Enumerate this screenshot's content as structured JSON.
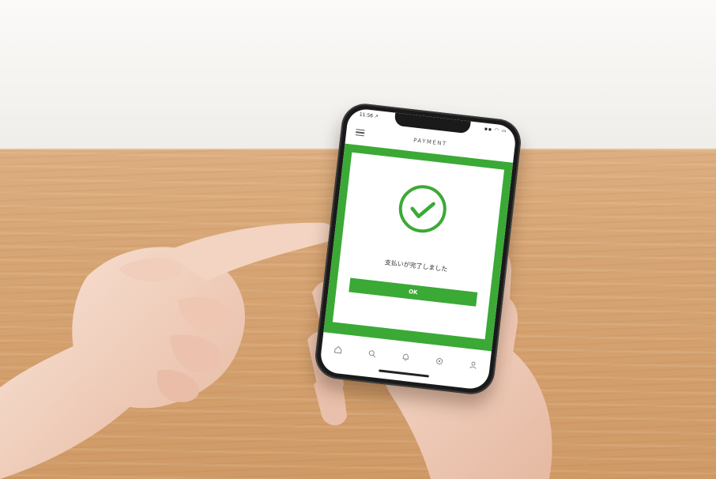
{
  "phone": {
    "status": {
      "time": "11:56 ↗",
      "icons": "▪▪ ◠ ▭"
    },
    "header": {
      "title": "PAYMENT",
      "menu_icon": "hamburger-menu-icon"
    },
    "dialog": {
      "icon": "check-circle-icon",
      "message": "支払いが完了しました",
      "ok_label": "OK"
    },
    "tab_bar": {
      "icons": [
        "home-icon",
        "search-icon",
        "bell-icon",
        "settings-icon",
        "profile-icon"
      ]
    }
  },
  "colors": {
    "accent_green": "#3ba935",
    "screen_white": "#ffffff",
    "phone_black": "#1a1a1a",
    "table_wood": "#d6a473"
  }
}
